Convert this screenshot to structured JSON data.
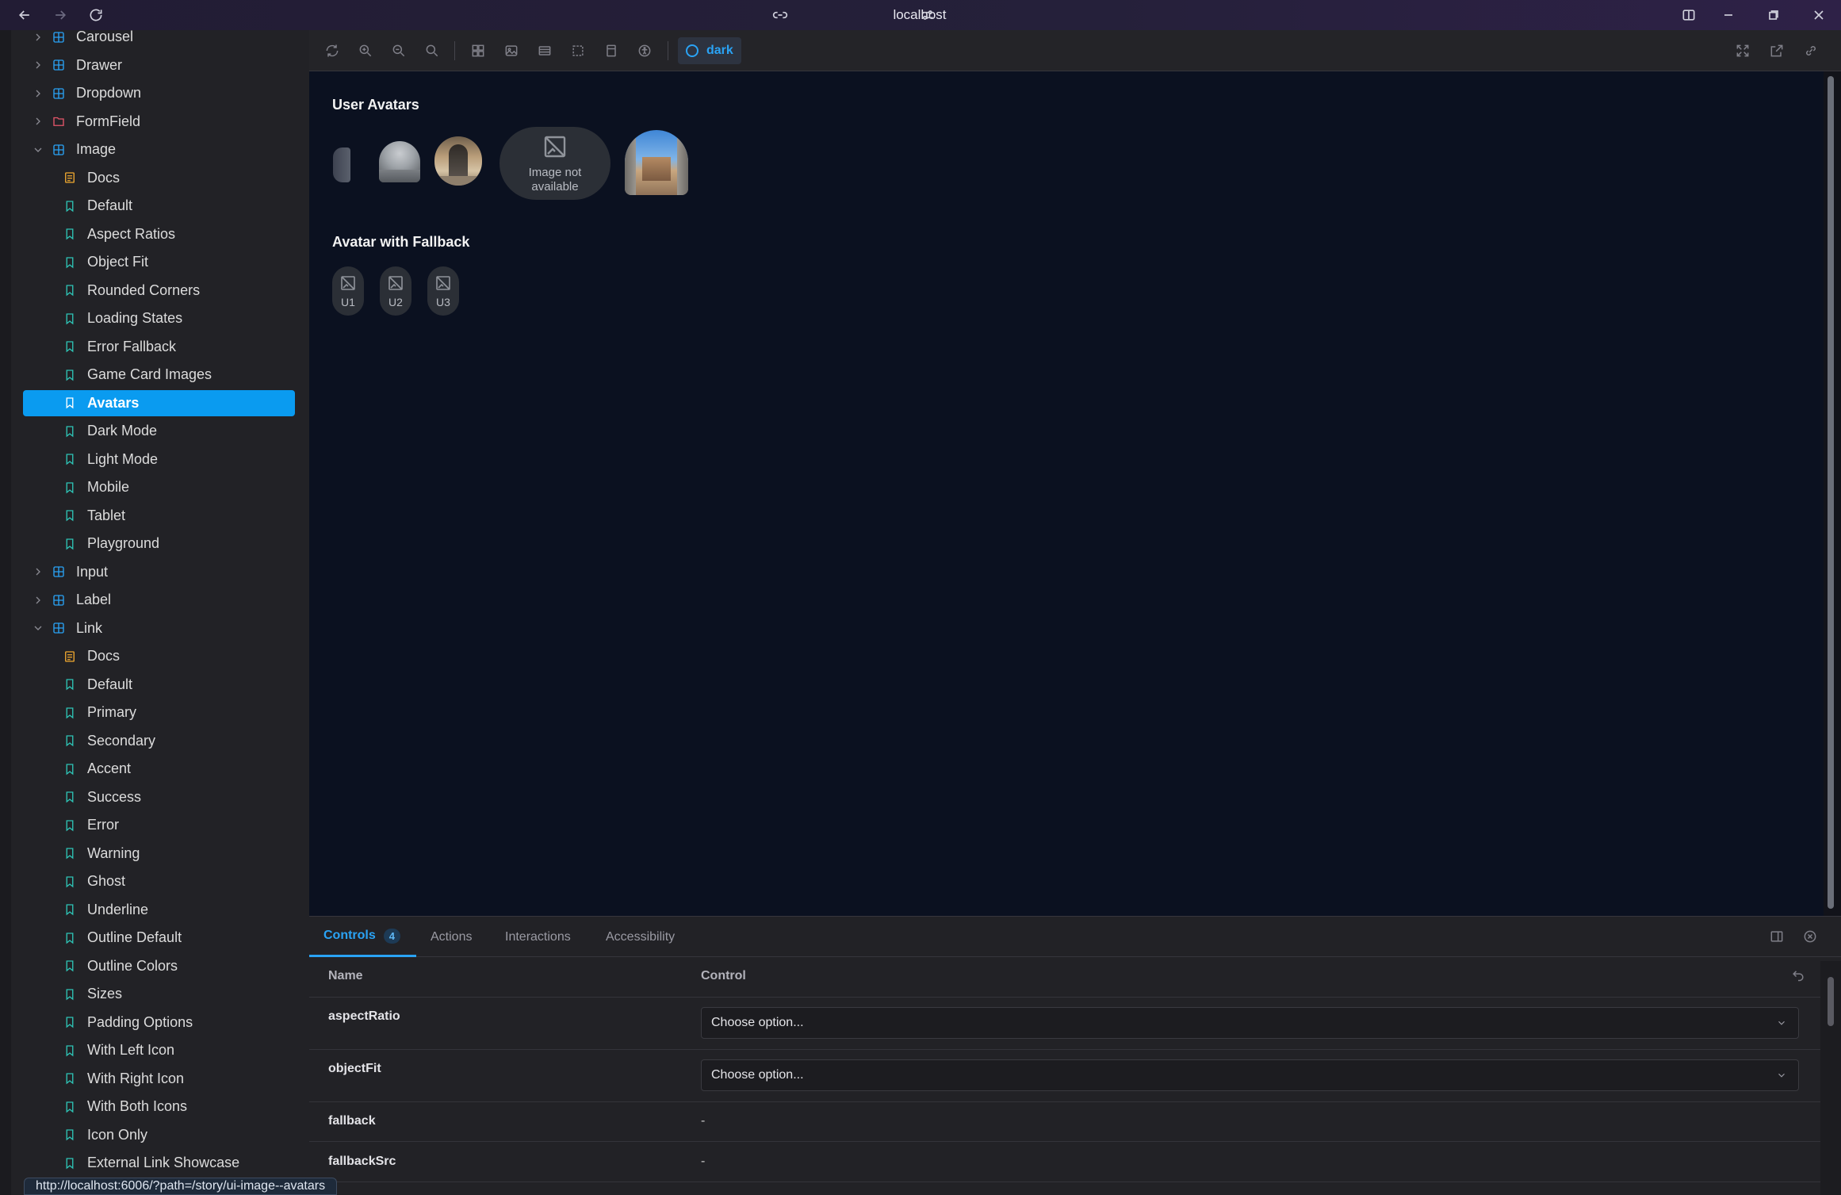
{
  "browser": {
    "address": "localhost",
    "status_url": "http://localhost:6006/?path=/story/ui-image--avatars"
  },
  "sidebar": {
    "components_top": [
      {
        "label": "Carousel",
        "icon": "component-icon",
        "color": "#2aa3f5"
      },
      {
        "label": "Drawer",
        "icon": "component-icon",
        "color": "#2aa3f5"
      },
      {
        "label": "Dropdown",
        "icon": "component-icon",
        "color": "#2aa3f5"
      },
      {
        "label": "FormField",
        "icon": "folder-icon",
        "color": "#e5566a"
      },
      {
        "label": "Image",
        "icon": "component-icon",
        "color": "#2aa3f5",
        "expanded": true
      }
    ],
    "image_stories": [
      {
        "label": "Docs",
        "type": "doc"
      },
      {
        "label": "Default",
        "type": "story"
      },
      {
        "label": "Aspect Ratios",
        "type": "story"
      },
      {
        "label": "Object Fit",
        "type": "story"
      },
      {
        "label": "Rounded Corners",
        "type": "story"
      },
      {
        "label": "Loading States",
        "type": "story"
      },
      {
        "label": "Error Fallback",
        "type": "story"
      },
      {
        "label": "Game Card Images",
        "type": "story"
      },
      {
        "label": "Avatars",
        "type": "story",
        "selected": true
      },
      {
        "label": "Dark Mode",
        "type": "story"
      },
      {
        "label": "Light Mode",
        "type": "story"
      },
      {
        "label": "Mobile",
        "type": "story"
      },
      {
        "label": "Tablet",
        "type": "story"
      },
      {
        "label": "Playground",
        "type": "story"
      }
    ],
    "components_mid": [
      {
        "label": "Input"
      },
      {
        "label": "Label"
      },
      {
        "label": "Link",
        "expanded": true
      }
    ],
    "link_stories": [
      {
        "label": "Docs",
        "type": "doc"
      },
      {
        "label": "Default",
        "type": "story"
      },
      {
        "label": "Primary",
        "type": "story"
      },
      {
        "label": "Secondary",
        "type": "story"
      },
      {
        "label": "Accent",
        "type": "story"
      },
      {
        "label": "Success",
        "type": "story"
      },
      {
        "label": "Error",
        "type": "story"
      },
      {
        "label": "Warning",
        "type": "story"
      },
      {
        "label": "Ghost",
        "type": "story"
      },
      {
        "label": "Underline",
        "type": "story"
      },
      {
        "label": "Outline Default",
        "type": "story"
      },
      {
        "label": "Outline Colors",
        "type": "story"
      },
      {
        "label": "Sizes",
        "type": "story"
      },
      {
        "label": "Padding Options",
        "type": "story"
      },
      {
        "label": "With Left Icon",
        "type": "story"
      },
      {
        "label": "With Right Icon",
        "type": "story"
      },
      {
        "label": "With Both Icons",
        "type": "story"
      },
      {
        "label": "Icon Only",
        "type": "story"
      },
      {
        "label": "External Link Showcase",
        "type": "story"
      }
    ]
  },
  "toolbar": {
    "theme_label": "dark"
  },
  "canvas": {
    "section1_title": "User Avatars",
    "fallback_text_line1": "Image not",
    "fallback_text_line2": "available",
    "section2_title": "Avatar with Fallback",
    "fallback_avatars": [
      "U1",
      "U2",
      "U3"
    ]
  },
  "panel": {
    "tabs": [
      {
        "label": "Controls",
        "count": "4",
        "active": true
      },
      {
        "label": "Actions"
      },
      {
        "label": "Interactions"
      },
      {
        "label": "Accessibility"
      }
    ],
    "header_name": "Name",
    "header_control": "Control",
    "rows": [
      {
        "name": "aspectRatio",
        "value": "Choose option...",
        "kind": "select"
      },
      {
        "name": "objectFit",
        "value": "Choose option...",
        "kind": "select"
      },
      {
        "name": "fallback",
        "value": "-",
        "kind": "text"
      },
      {
        "name": "fallbackSrc",
        "value": "-",
        "kind": "text"
      }
    ]
  },
  "colors": {
    "accent": "#0a9bf0",
    "canvas_bg": "#0b1120",
    "sidebar_bg": "#222226",
    "component_icon": "#2aa3f5",
    "story_icon": "#2ec4b6",
    "doc_icon": "#f0a830",
    "folder_icon": "#e5566a"
  }
}
